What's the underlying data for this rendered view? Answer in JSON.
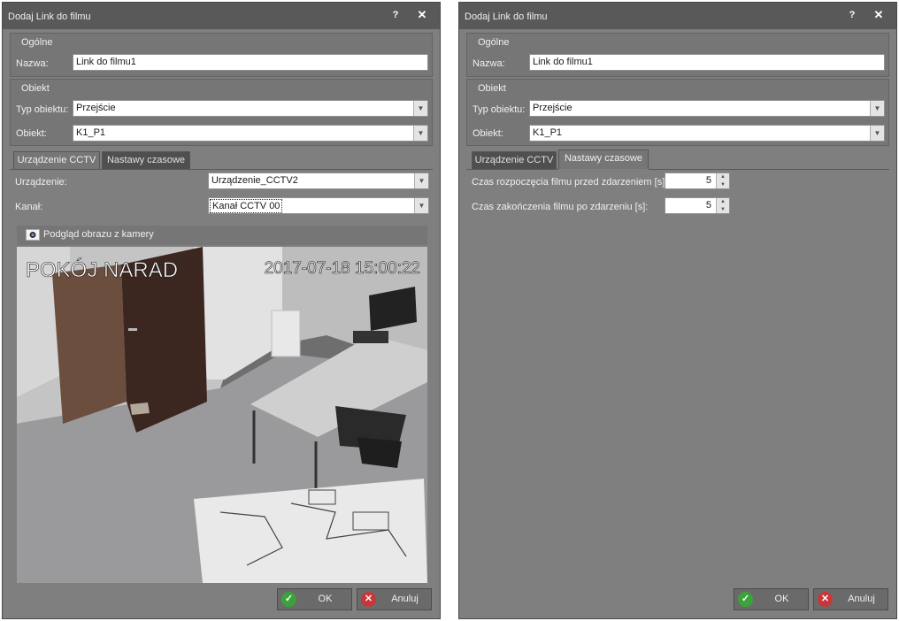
{
  "left_window": {
    "title": "Dodaj Link do filmu",
    "help_glyph": "?",
    "close_glyph": "✕",
    "general_group": {
      "title": "Ogólne",
      "name_label": "Nazwa:",
      "name_value": "Link do filmu1"
    },
    "object_group": {
      "title": "Obiekt",
      "type_label": "Typ obiektu:",
      "type_value": "Przejście",
      "object_label": "Obiekt:",
      "object_value": "K1_P1"
    },
    "tabs": [
      {
        "label": "Urządzenie CCTV",
        "active": true
      },
      {
        "label": "Nastawy czasowe",
        "active": false
      }
    ],
    "cctv": {
      "device_label": "Urządzenie:",
      "device_value": "Urządzenie_CCTV2",
      "channel_label": "Kanał:",
      "channel_value": "Kanał CCTV 00",
      "preview_label": "Podgląd obrazu z kamery",
      "overlay_room": "POKÓJ NARAD",
      "overlay_timestamp": "2017-07-18 15:00:22"
    },
    "ok_label": "OK",
    "cancel_label": "Anuluj"
  },
  "right_window": {
    "title": "Dodaj Link do filmu",
    "help_glyph": "?",
    "close_glyph": "✕",
    "general_group": {
      "title": "Ogólne",
      "name_label": "Nazwa:",
      "name_value": "Link do filmu1"
    },
    "object_group": {
      "title": "Obiekt",
      "type_label": "Typ obiektu:",
      "type_value": "Przejście",
      "object_label": "Obiekt:",
      "object_value": "K1_P1"
    },
    "tabs": [
      {
        "label": "Urządzenie CCTV",
        "active": false
      },
      {
        "label": "Nastawy czasowe",
        "active": true
      }
    ],
    "timing": {
      "start_label": "Czas rozpoczęcia filmu przed zdarzeniem [s]:",
      "start_value": "5",
      "end_label": "Czas zakończenia filmu po zdarzeniu [s]:",
      "end_value": "5"
    },
    "ok_label": "OK",
    "cancel_label": "Anuluj"
  },
  "icons": {
    "dropdown": "chevron-down-icon",
    "spin_up": "spin-up-icon",
    "spin_down": "spin-down-icon",
    "ok": "check-icon",
    "cancel": "cross-icon",
    "camera": "camera-icon"
  },
  "colors": {
    "window_bg": "#7f7f7f",
    "titlebar_bg": "#595959",
    "tab_inactive": "#4f4f4f",
    "ok_green": "#3aa33a",
    "cancel_red": "#c8363a"
  }
}
